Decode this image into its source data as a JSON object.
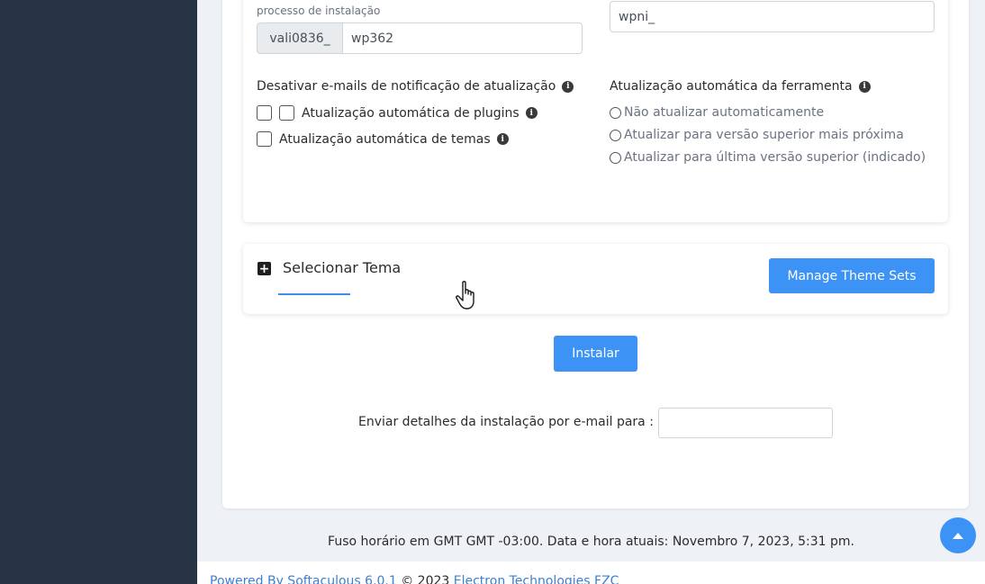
{
  "install_form": {
    "prefix_label": "processo de instalação",
    "prefix_addon": "vali0836_",
    "prefix_value": "wp362",
    "db_prefix_value": "wpni_"
  },
  "notifications": {
    "title": "Desativar e-mails de notificação de atualização",
    "plugins_label": "Atualização automática de plugins",
    "themes_label": "Atualização automática de temas"
  },
  "auto_update": {
    "title": "Atualização automática da ferramenta",
    "options": [
      "Não atualizar automaticamente",
      "Atualizar para versão superior mais próxima",
      "Atualizar para última versão superior (indicado)"
    ]
  },
  "theme": {
    "title": "Selecionar Tema",
    "manage_button": "Manage Theme Sets"
  },
  "install_button": "Instalar",
  "email": {
    "label": "Enviar detalhes da instalação por e-mail para :",
    "value": ""
  },
  "timezone_text": "Fuso horário em GMT GMT -03:00. Data e hora atuais: Novembro 7, 2023, 5:31 pm.",
  "footer": {
    "powered_by": "Powered By Softaculous 6.0.1",
    "copyright": " © 2023 ",
    "company": "Electron Technologies FZC"
  },
  "colors": {
    "sidebar": "#263445",
    "accent": "#3d93f5"
  }
}
